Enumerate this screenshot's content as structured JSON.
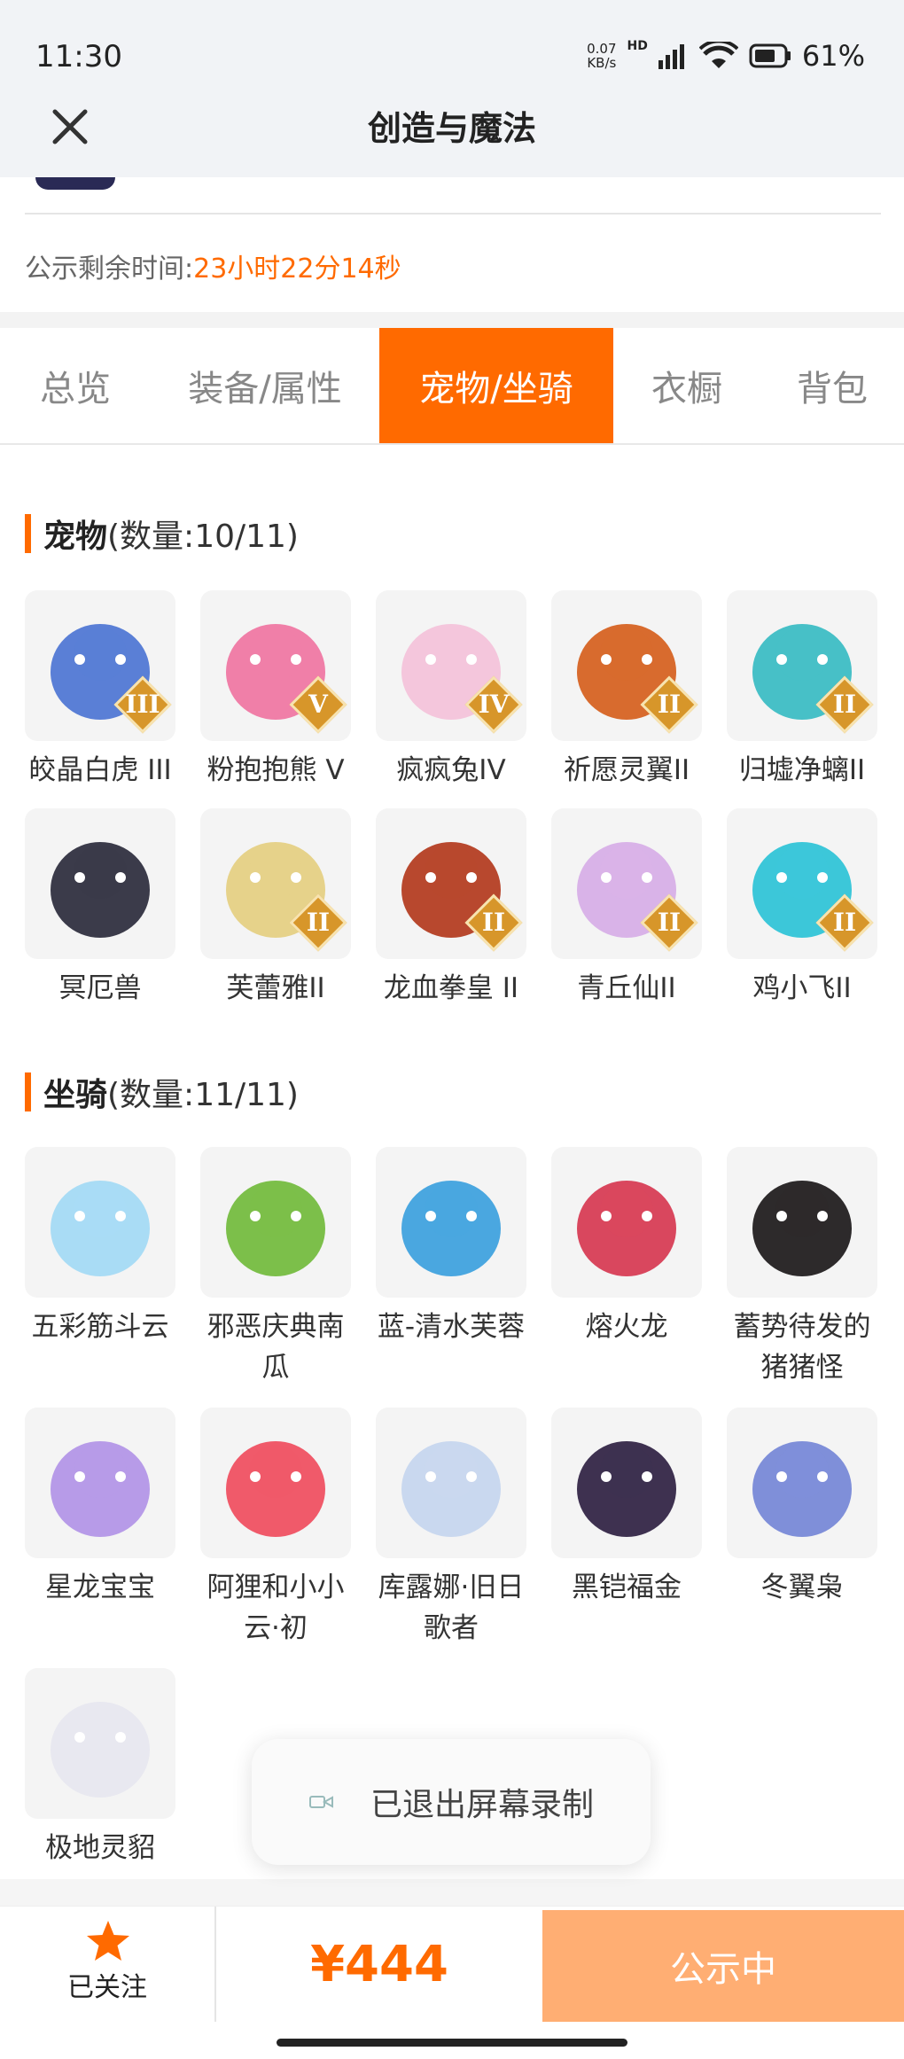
{
  "status_bar": {
    "time": "11:30",
    "net_speed_value": "0.07",
    "net_speed_unit": "KB/s",
    "network_type": "HD",
    "battery_percent": "61%"
  },
  "header": {
    "title": "创造与魔法"
  },
  "timer": {
    "label": "公示剩余时间:",
    "value": "23小时22分14秒"
  },
  "tabs": [
    {
      "label": "总览",
      "active": false
    },
    {
      "label": "装备/属性",
      "active": false
    },
    {
      "label": "宠物/坐骑",
      "active": true
    },
    {
      "label": "衣橱",
      "active": false
    },
    {
      "label": "背包",
      "active": false
    }
  ],
  "pets": {
    "title": "宠物",
    "count": "(数量:10/11)",
    "items": [
      {
        "name": "皎晶白虎 III",
        "badge": "III",
        "color": "#5a7fd6"
      },
      {
        "name": "粉抱抱熊 V",
        "badge": "V",
        "color": "#f07fa8"
      },
      {
        "name": "疯疯兔IV",
        "badge": "IV",
        "color": "#f4c6dc"
      },
      {
        "name": "祈愿灵翼II",
        "badge": "II",
        "color": "#d86b2e"
      },
      {
        "name": "归墟净螭II",
        "badge": "II",
        "color": "#47c0c7"
      },
      {
        "name": "冥厄兽",
        "badge": "",
        "color": "#3b3b4a"
      },
      {
        "name": "芙蕾雅II",
        "badge": "II",
        "color": "#e6d28a"
      },
      {
        "name": "龙血拳皇 II",
        "badge": "II",
        "color": "#b8482e"
      },
      {
        "name": "青丘仙II",
        "badge": "II",
        "color": "#d9b3e8"
      },
      {
        "name": "鸡小飞II",
        "badge": "II",
        "color": "#3cc7d9"
      }
    ]
  },
  "mounts": {
    "title": "坐骑",
    "count": "(数量:11/11)",
    "items": [
      {
        "name": "五彩筋斗云",
        "color": "#a9dcf5"
      },
      {
        "name": "邪恶庆典南瓜",
        "color": "#7cbf4a"
      },
      {
        "name": "蓝-清水芙蓉",
        "color": "#4aa7e0"
      },
      {
        "name": "熔火龙",
        "color": "#d9475e"
      },
      {
        "name": "蓄势待发的猪猪怪",
        "color": "#2d2a2b"
      },
      {
        "name": "星龙宝宝",
        "color": "#b79be8"
      },
      {
        "name": "阿狸和小小云·初",
        "color": "#f05a6a"
      },
      {
        "name": "库露娜·旧日歌者",
        "color": "#c9d8ef"
      },
      {
        "name": "黑铠福金",
        "color": "#3e3150"
      },
      {
        "name": "冬翼枭",
        "color": "#7f8fd9"
      },
      {
        "name": "极地灵貂",
        "color": "#e8e8f0"
      }
    ]
  },
  "toast": {
    "text": "已退出屏幕录制"
  },
  "bottom": {
    "follow_label": "已关注",
    "price": "¥444",
    "cta_label": "公示中"
  },
  "colors": {
    "accent": "#ff6a00",
    "cta": "#ffae73",
    "badge": "#d7962a"
  }
}
